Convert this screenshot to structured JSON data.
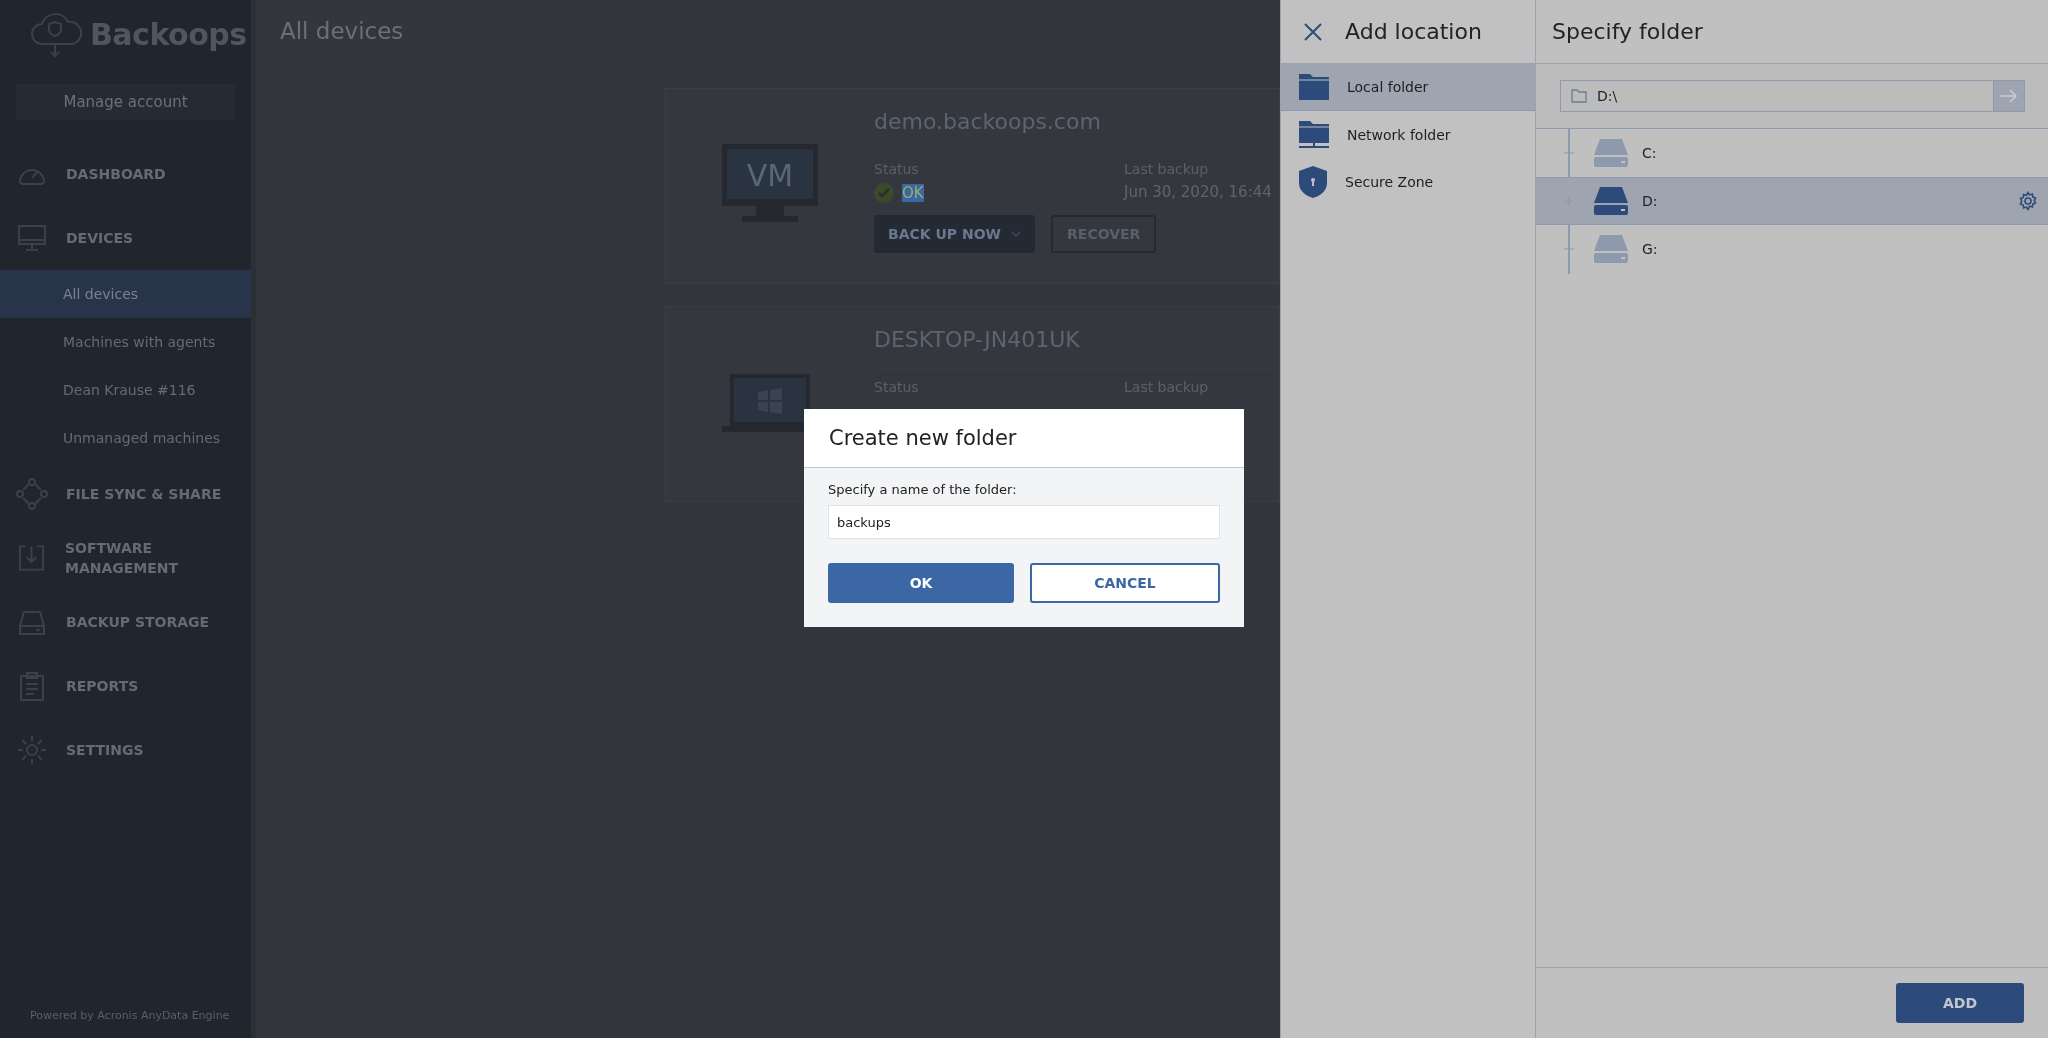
{
  "sidebar": {
    "logo": "Backoops",
    "manage_account": "Manage account",
    "nav": [
      {
        "label": "DASHBOARD"
      },
      {
        "label": "DEVICES",
        "children": [
          {
            "label": "All devices",
            "selected": true
          },
          {
            "label": "Machines with agents",
            "selected": false
          },
          {
            "label": "Dean Krause #116",
            "selected": false
          },
          {
            "label": "Unmanaged machines",
            "selected": false
          }
        ]
      },
      {
        "label": "FILE SYNC & SHARE"
      },
      {
        "label": "SOFTWARE MANAGEMENT"
      },
      {
        "label": "BACKUP STORAGE"
      },
      {
        "label": "REPORTS"
      },
      {
        "label": "SETTINGS"
      }
    ],
    "footer": "Powered by Acronis AnyData Engine"
  },
  "main": {
    "title": "All devices",
    "devices": [
      {
        "kind": "vm",
        "screen_label": "VM",
        "name": "demo.backoops.com",
        "status_label": "Status",
        "status": "OK",
        "last_backup_label": "Last backup",
        "last_backup": "Jun 30, 2020, 16:44",
        "backup_button": "BACK UP NOW",
        "recover_button": "RECOVER"
      },
      {
        "kind": "laptop",
        "name": "DESKTOP-JN401UK",
        "status_label": "Status",
        "last_backup_label": "Last backup"
      }
    ]
  },
  "add_location": {
    "title": "Add location",
    "items": [
      {
        "label": "Local folder",
        "selected": true
      },
      {
        "label": "Network folder",
        "selected": false
      },
      {
        "label": "Secure Zone",
        "selected": false
      }
    ]
  },
  "specify_folder": {
    "title": "Specify folder",
    "path": "D:\\",
    "drives": [
      {
        "label": "C:",
        "selected": false
      },
      {
        "label": "D:",
        "selected": true
      },
      {
        "label": "G:",
        "selected": false
      }
    ],
    "add_button": "ADD"
  },
  "dialog": {
    "title": "Create new folder",
    "field_label": "Specify a name of the folder:",
    "value": "backups",
    "ok_button": "OK",
    "cancel_button": "CANCEL"
  }
}
